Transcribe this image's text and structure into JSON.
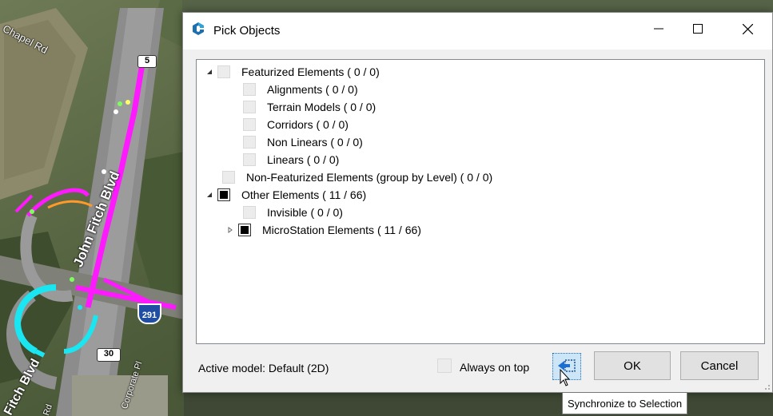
{
  "map": {
    "labels": {
      "chapel_rd": "Chapel Rd",
      "john_fitch_blvd": "John Fitch Blvd",
      "fitch_blvd_lower": "Fitch Blvd",
      "corporate_pl": "Corporate Pl",
      "rd_lower": "Rd"
    },
    "shields": {
      "route_5": "5",
      "route_30": "30",
      "interstate_291": "291"
    },
    "colors": {
      "highlight": "#ff19ff",
      "cyan": "#19e6f0",
      "green": "#7cff5a"
    }
  },
  "dialog": {
    "title": "Pick Objects",
    "app_icon": "bentley-app-icon",
    "minimize_icon": "minimize-icon",
    "maximize_icon": "maximize-icon",
    "close_icon": "close-icon",
    "tree": [
      {
        "label": "Featurized Elements ( 0 / 0)",
        "level": 0,
        "expander": "expanded",
        "state": "empty"
      },
      {
        "label": "Alignments ( 0 / 0)",
        "level": 1,
        "expander": "none",
        "state": "empty"
      },
      {
        "label": "Terrain Models ( 0 / 0)",
        "level": 1,
        "expander": "none",
        "state": "empty"
      },
      {
        "label": "Corridors ( 0 / 0)",
        "level": 1,
        "expander": "none",
        "state": "empty"
      },
      {
        "label": "Non Linears ( 0 / 0)",
        "level": 1,
        "expander": "none",
        "state": "empty"
      },
      {
        "label": "Linears ( 0 / 0)",
        "level": 1,
        "expander": "none",
        "state": "empty"
      },
      {
        "label": "Non-Featurized Elements (group by Level) ( 0 / 0)",
        "level": 0,
        "expander": "none",
        "state": "empty"
      },
      {
        "label": "Other Elements ( 11 / 66)",
        "level": 0,
        "expander": "expanded",
        "state": "partial"
      },
      {
        "label": "Invisible ( 0 / 0)",
        "level": 1,
        "expander": "none",
        "state": "empty"
      },
      {
        "label": "MicroStation Elements ( 11 / 66)",
        "level": 1,
        "expander": "collapsed",
        "state": "partial"
      }
    ],
    "footer": {
      "active_model": "Active model: Default (2D)",
      "always_on_top": "Always on top",
      "always_on_top_checked": false,
      "sync_icon": "synchronize-selection-icon",
      "ok": "OK",
      "cancel": "Cancel"
    }
  },
  "tooltip": "Synchronize to Selection"
}
